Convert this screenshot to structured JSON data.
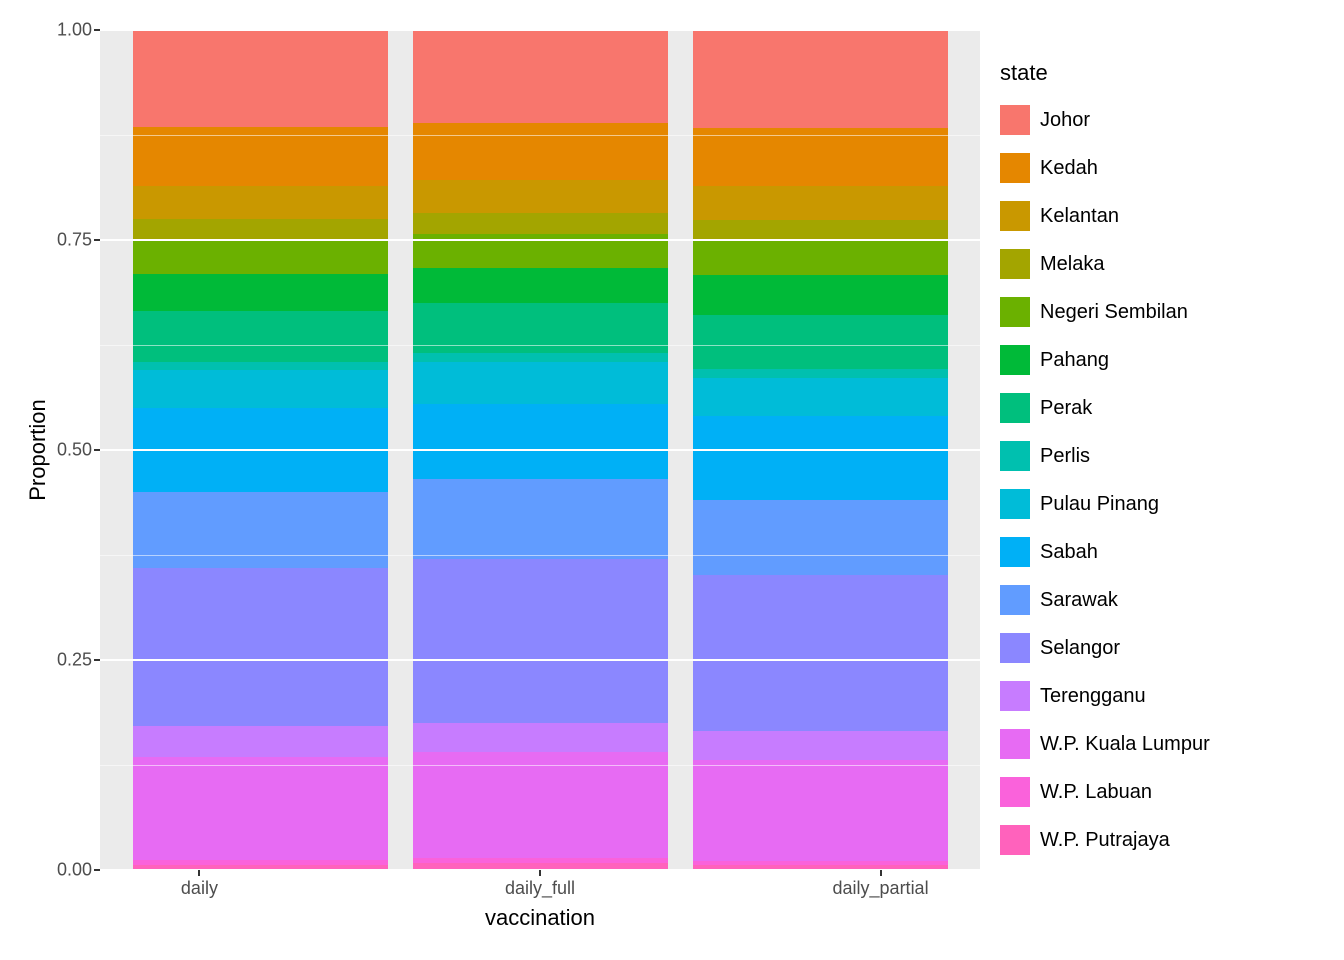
{
  "axis": {
    "ylabel": "Proportion",
    "xlabel": "vaccination",
    "yticks": [
      "0.00",
      "0.25",
      "0.50",
      "0.75",
      "1.00"
    ],
    "xcategories": [
      "daily",
      "daily_full",
      "daily_partial"
    ]
  },
  "legend": {
    "title": "state",
    "items": [
      {
        "label": "Johor",
        "color": "#F8766D"
      },
      {
        "label": "Kedah",
        "color": "#E58700"
      },
      {
        "label": "Kelantan",
        "color": "#C99800"
      },
      {
        "label": "Melaka",
        "color": "#A3A500"
      },
      {
        "label": "Negeri Sembilan",
        "color": "#6BB100"
      },
      {
        "label": "Pahang",
        "color": "#00BA38"
      },
      {
        "label": "Perak",
        "color": "#00BF7D"
      },
      {
        "label": "Perlis",
        "color": "#00C0AF"
      },
      {
        "label": "Pulau Pinang",
        "color": "#00BCD8"
      },
      {
        "label": "Sabah",
        "color": "#00B0F6"
      },
      {
        "label": "Sarawak",
        "color": "#619CFF"
      },
      {
        "label": "Selangor",
        "color": "#8B87FF"
      },
      {
        "label": "Terengganu",
        "color": "#C77CFF"
      },
      {
        "label": "W.P. Kuala Lumpur",
        "color": "#E76BF3"
      },
      {
        "label": "W.P. Labuan",
        "color": "#FA62DB"
      },
      {
        "label": "W.P. Putrajaya",
        "color": "#FF62BC"
      }
    ]
  },
  "chart_data": {
    "type": "bar",
    "stacked": true,
    "normalized": true,
    "title": "",
    "xlabel": "vaccination",
    "ylabel": "Proportion",
    "ylim": [
      0,
      1
    ],
    "categories": [
      "daily",
      "daily_full",
      "daily_partial"
    ],
    "series": [
      {
        "name": "W.P. Putrajaya",
        "color": "#FF62BC",
        "values": [
          0.006,
          0.008,
          0.006
        ]
      },
      {
        "name": "W.P. Labuan",
        "color": "#FA62DB",
        "values": [
          0.006,
          0.006,
          0.005
        ]
      },
      {
        "name": "W.P. Kuala Lumpur",
        "color": "#E76BF3",
        "values": [
          0.122,
          0.126,
          0.12
        ]
      },
      {
        "name": "Terengganu",
        "color": "#C77CFF",
        "values": [
          0.038,
          0.035,
          0.035
        ]
      },
      {
        "name": "Selangor",
        "color": "#8B87FF",
        "values": [
          0.188,
          0.195,
          0.185
        ]
      },
      {
        "name": "Sarawak",
        "color": "#619CFF",
        "values": [
          0.09,
          0.095,
          0.09
        ]
      },
      {
        "name": "Sabah",
        "color": "#00B0F6",
        "values": [
          0.1,
          0.09,
          0.1
        ]
      },
      {
        "name": "Pulau Pinang",
        "color": "#00BCD8",
        "values": [
          0.045,
          0.05,
          0.045
        ]
      },
      {
        "name": "Perlis",
        "color": "#00C0AF",
        "values": [
          0.01,
          0.01,
          0.01
        ]
      },
      {
        "name": "Perak",
        "color": "#00BF7D",
        "values": [
          0.06,
          0.06,
          0.065
        ]
      },
      {
        "name": "Pahang",
        "color": "#00BA38",
        "values": [
          0.045,
          0.042,
          0.048
        ]
      },
      {
        "name": "Negeri Sembilan",
        "color": "#6BB100",
        "values": [
          0.04,
          0.04,
          0.04
        ]
      },
      {
        "name": "Melaka",
        "color": "#A3A500",
        "values": [
          0.025,
          0.025,
          0.025
        ]
      },
      {
        "name": "Kelantan",
        "color": "#C99800",
        "values": [
          0.04,
          0.04,
          0.04
        ]
      },
      {
        "name": "Kedah",
        "color": "#E58700",
        "values": [
          0.07,
          0.068,
          0.07
        ]
      },
      {
        "name": "Johor",
        "color": "#F8766D",
        "values": [
          0.115,
          0.11,
          0.116
        ]
      }
    ]
  }
}
